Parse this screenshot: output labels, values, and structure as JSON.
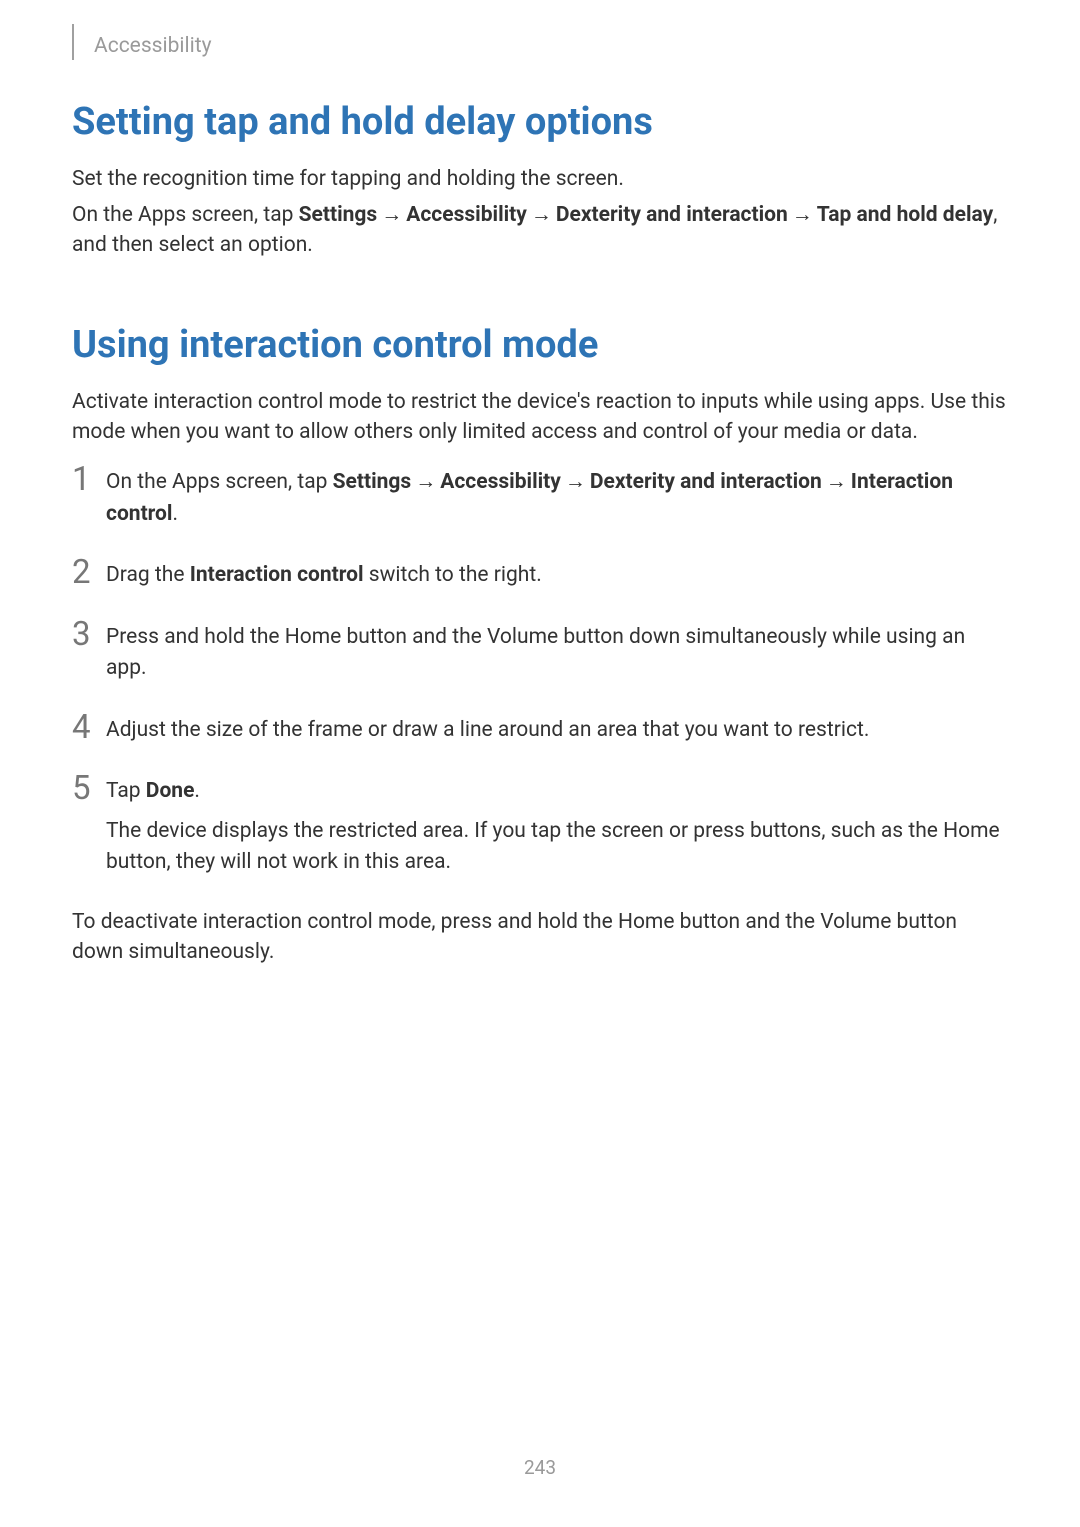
{
  "header": {
    "section_label": "Accessibility"
  },
  "section1": {
    "heading": "Setting tap and hold delay options",
    "p1": "Set the recognition time for tapping and holding the screen.",
    "p2_prefix": "On the Apps screen, tap ",
    "nav1": "Settings",
    "nav2": "Accessibility",
    "nav3": "Dexterity and interaction",
    "nav4": "Tap and hold delay",
    "p2_suffix": ", and then select an option."
  },
  "section2": {
    "heading": "Using interaction control mode",
    "p1": "Activate interaction control mode to restrict the device's reaction to inputs while using apps. Use this mode when you want to allow others only limited access and control of your media or data.",
    "steps": {
      "n1": "1",
      "s1_prefix": "On the Apps screen, tap ",
      "s1_nav1": "Settings",
      "s1_nav2": "Accessibility",
      "s1_nav3": "Dexterity and interaction",
      "s1_nav4": "Interaction control",
      "s1_suffix": ".",
      "n2": "2",
      "s2_prefix": "Drag the ",
      "s2_bold": "Interaction control",
      "s2_suffix": " switch to the right.",
      "n3": "3",
      "s3": "Press and hold the Home button and the Volume button down simultaneously while using an app.",
      "n4": "4",
      "s4": "Adjust the size of the frame or draw a line around an area that you want to restrict.",
      "n5": "5",
      "s5_prefix": "Tap ",
      "s5_bold": "Done",
      "s5_suffix": ".",
      "s5_followup": "The device displays the restricted area. If you tap the screen or press buttons, such as the Home button, they will not work in this area."
    },
    "closing": "To deactivate interaction control mode, press and hold the Home button and the Volume button down simultaneously."
  },
  "arrow": "→",
  "page_number": "243"
}
